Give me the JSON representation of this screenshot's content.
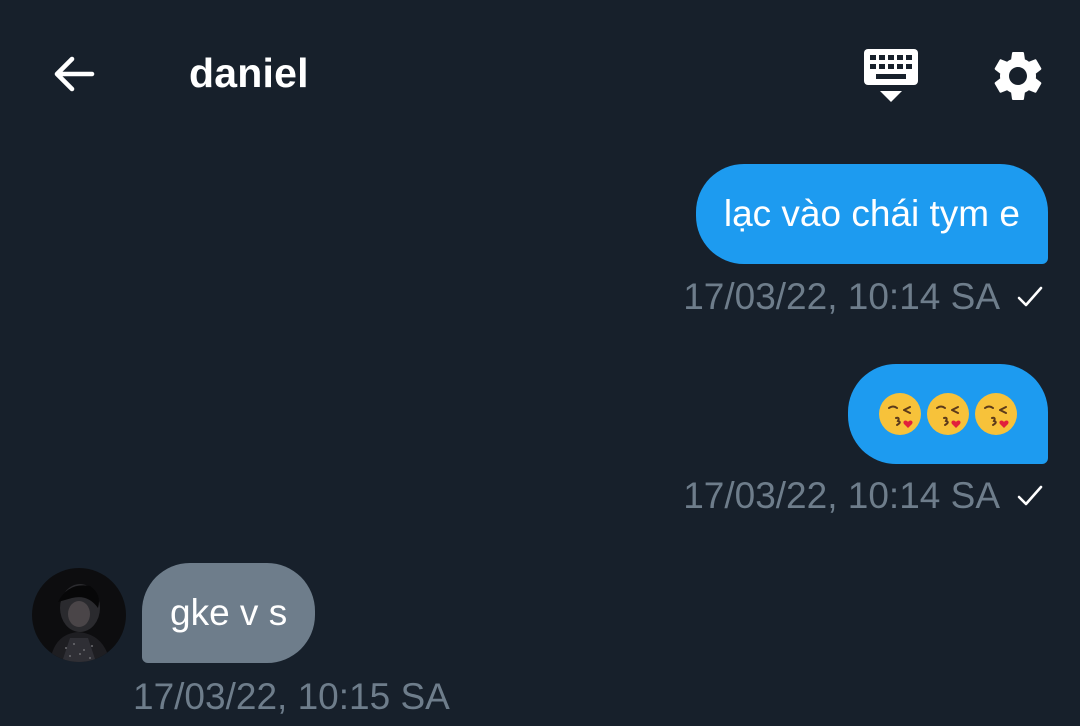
{
  "header": {
    "title": "daniel",
    "back_icon": "arrow-left-icon",
    "keyboard_icon": "keyboard-hide-icon",
    "settings_icon": "gear-icon"
  },
  "messages": [
    {
      "direction": "outgoing",
      "text": "lạc vào chái tym e",
      "timestamp": "17/03/22, 10:14 SA",
      "status_icon": "check-icon"
    },
    {
      "direction": "outgoing",
      "text": "😘😘😘",
      "emoji_icon": "face-blowing-kiss-emoji",
      "timestamp": "17/03/22, 10:14 SA",
      "status_icon": "check-icon"
    },
    {
      "direction": "incoming",
      "text": "gke v s",
      "timestamp": "17/03/22, 10:15 SA",
      "avatar_icon": "avatar"
    }
  ],
  "colors": {
    "background": "#17202b",
    "outgoing_bubble": "#1d9bf0",
    "incoming_bubble": "#6e7d8b",
    "timestamp": "#6e7d8b",
    "text": "#ffffff"
  }
}
